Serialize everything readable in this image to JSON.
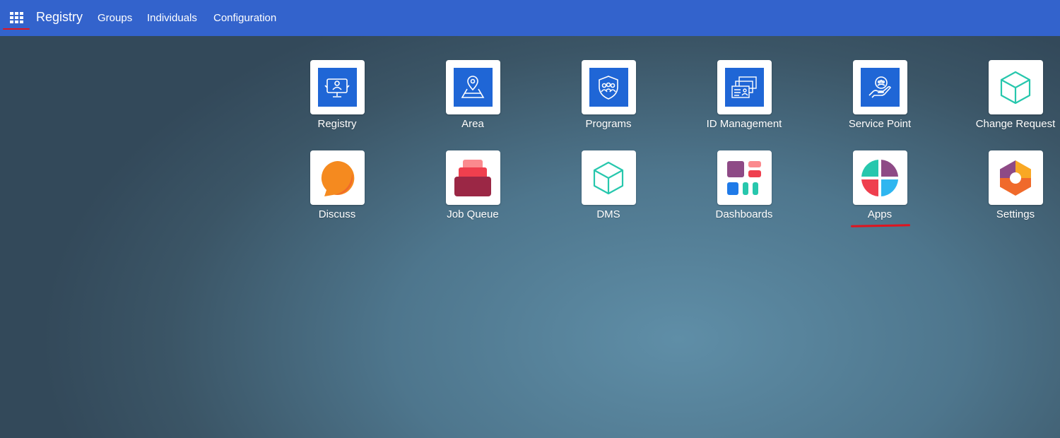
{
  "navbar": {
    "toggle_icon": "apps-grid-icon",
    "brand": "Registry",
    "menu": [
      "Groups",
      "Individuals",
      "Configuration"
    ]
  },
  "apps": [
    {
      "label": "Registry",
      "icon": "registry-monitor-icon"
    },
    {
      "label": "Area",
      "icon": "area-map-pin-icon"
    },
    {
      "label": "Programs",
      "icon": "programs-shield-icon"
    },
    {
      "label": "ID Management",
      "icon": "id-cards-icon"
    },
    {
      "label": "Service Point",
      "icon": "service-hand-icon"
    },
    {
      "label": "Change Request",
      "icon": "change-request-cube-icon"
    },
    {
      "label": "Discuss",
      "icon": "discuss-bubble-icon"
    },
    {
      "label": "Job Queue",
      "icon": "job-queue-stack-icon"
    },
    {
      "label": "DMS",
      "icon": "dms-cube-icon"
    },
    {
      "label": "Dashboards",
      "icon": "dashboards-icon"
    },
    {
      "label": "Apps",
      "icon": "apps-quadrant-icon"
    },
    {
      "label": "Settings",
      "icon": "settings-hexagon-icon"
    }
  ],
  "colors": {
    "navbar": "#3363cc",
    "tile_blue": "#1f66d6",
    "teal": "#27c7ad",
    "annotation_red": "#e0141e"
  }
}
